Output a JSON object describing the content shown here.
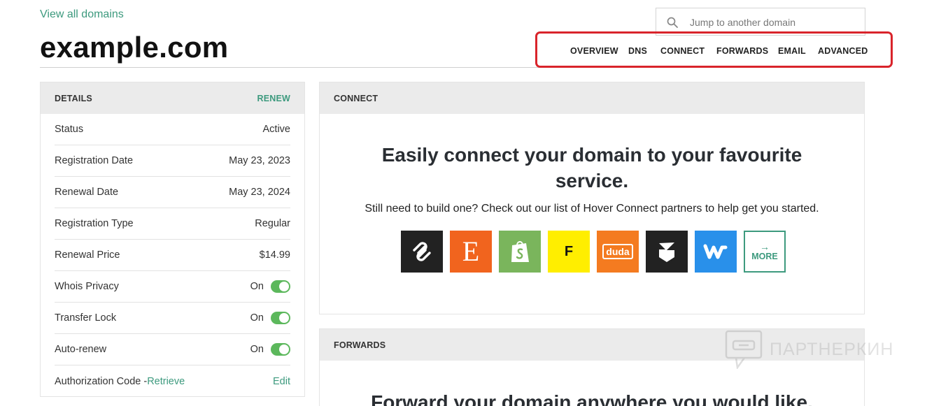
{
  "header": {
    "view_all": "View all domains",
    "domain": "example.com",
    "search_placeholder": "Jump to another domain"
  },
  "nav": [
    {
      "label": "OVERVIEW"
    },
    {
      "label": "DNS"
    },
    {
      "label": "CONNECT"
    },
    {
      "label": "FORWARDS"
    },
    {
      "label": "EMAIL"
    },
    {
      "label": "ADVANCED"
    }
  ],
  "details": {
    "heading": "DETAILS",
    "renew": "RENEW",
    "rows": [
      {
        "label": "Status",
        "value": "Active"
      },
      {
        "label": "Registration Date",
        "value": "May 23, 2023"
      },
      {
        "label": "Renewal Date",
        "value": "May 23, 2024"
      },
      {
        "label": "Registration Type",
        "value": "Regular"
      },
      {
        "label": "Renewal Price",
        "value": "$14.99"
      },
      {
        "label": "Whois Privacy",
        "value": "On"
      },
      {
        "label": "Transfer Lock",
        "value": "On"
      },
      {
        "label": "Auto-renew",
        "value": "On"
      }
    ],
    "auth_label": "Authorization Code -",
    "auth_link": "Retrieve",
    "auth_edit": "Edit"
  },
  "connect": {
    "heading": "CONNECT",
    "title": "Easily connect your domain to your favourite service.",
    "subtitle": "Still need to build one? Check out our list of Hover Connect partners to help get you started.",
    "partner_icons": [
      "squarespace-icon",
      "etsy-icon",
      "shopify-icon",
      "f-icon",
      "duda-icon",
      "bigcommerce-icon",
      "weebly-icon"
    ],
    "etsy_letter": "E",
    "f_letter": "F",
    "duda_label": "duda",
    "more_label": "MORE",
    "colors": {
      "squarespace": "#222222",
      "etsy": "#f1641e",
      "shopify": "#7ab55c",
      "f": "#ffee00",
      "duda": "#f47b20",
      "bigcommerce": "#222222",
      "weebly": "#2990ea"
    }
  },
  "forwards": {
    "heading": "FORWARDS",
    "title": "Forward your domain anywhere you would like."
  },
  "watermark": "ПАРТНЕРКИН",
  "colors": {
    "accent": "#3d9a7e",
    "highlight": "#d9242b",
    "toggle": "#5cb85c"
  }
}
